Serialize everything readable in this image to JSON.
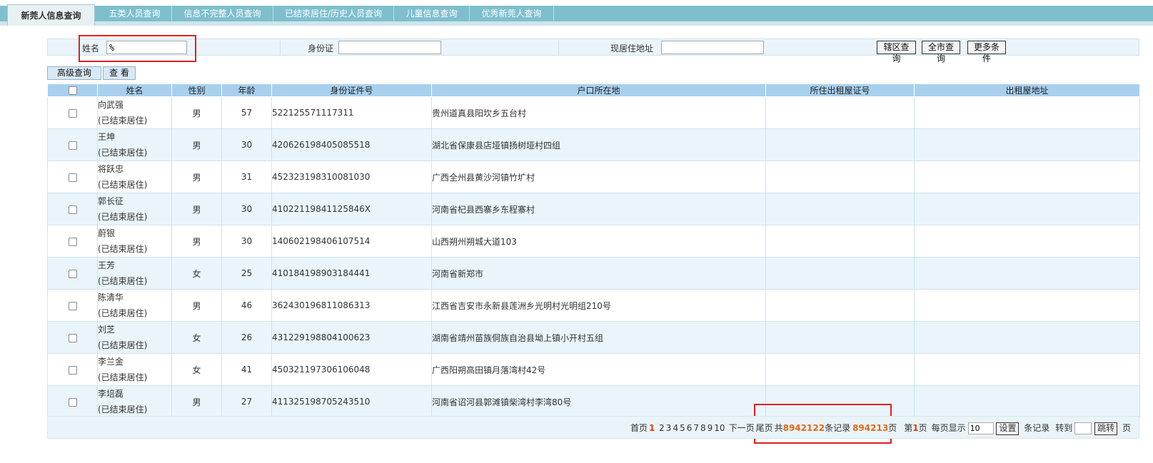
{
  "tabs": [
    {
      "label": "新莞人信息查询",
      "active": true
    },
    {
      "label": "五类人员查询",
      "active": false
    },
    {
      "label": "信息不完整人员查询",
      "active": false
    },
    {
      "label": "已结束居住/历史人员查询",
      "active": false
    },
    {
      "label": "儿童信息查询",
      "active": false
    },
    {
      "label": "优秀新莞人查询",
      "active": false
    }
  ],
  "search": {
    "name_label": "姓名",
    "name_value": "%",
    "id_label": "身份证",
    "id_value": "",
    "address_label": "现居住地址",
    "address_value": "",
    "btn_district": "辖区查询",
    "btn_city": "全市查询",
    "btn_more": "更多条件",
    "btn_advanced": "高级查询",
    "btn_view": "查 看"
  },
  "table": {
    "headers": [
      "",
      "姓名",
      "性别",
      "年龄",
      "身份证件号",
      "户口所在地",
      "所住出租屋证号",
      "出租屋地址"
    ],
    "rows": [
      {
        "name": "向武强",
        "status": "(已结束居住)",
        "gender": "男",
        "age": "57",
        "id": "522125571117311",
        "hukou": "贵州道真县阳坎乡五台村",
        "room_no": "",
        "room_addr": ""
      },
      {
        "name": "王坤",
        "status": "(已结束居住)",
        "gender": "男",
        "age": "30",
        "id": "420626198405085518",
        "hukou": "湖北省保康县店垭镇扬树垭村四组",
        "room_no": "",
        "room_addr": ""
      },
      {
        "name": "将跃忠",
        "status": "(已结束居住)",
        "gender": "男",
        "age": "31",
        "id": "452323198310081030",
        "hukou": "广西全州县黄沙河镇竹圹村",
        "room_no": "",
        "room_addr": ""
      },
      {
        "name": "郭长征",
        "status": "(已结束居住)",
        "gender": "男",
        "age": "30",
        "id": "41022119841125846X",
        "hukou": "河南省杞县西寨乡东程寨村",
        "room_no": "",
        "room_addr": ""
      },
      {
        "name": "蔚银",
        "status": "(已结束居住)",
        "gender": "男",
        "age": "30",
        "id": "140602198406107514",
        "hukou": "山西朔州朔城大道103",
        "room_no": "",
        "room_addr": ""
      },
      {
        "name": "王芳",
        "status": "(已结束居住)",
        "gender": "女",
        "age": "25",
        "id": "410184198903184441",
        "hukou": "河南省新郑市",
        "room_no": "",
        "room_addr": ""
      },
      {
        "name": "陈清华",
        "status": "(已结束居住)",
        "gender": "男",
        "age": "46",
        "id": "362430196811086313",
        "hukou": "江西省吉安市永新县莲洲乡光明村光明组210号",
        "room_no": "",
        "room_addr": ""
      },
      {
        "name": "刘芝",
        "status": "(已结束居住)",
        "gender": "女",
        "age": "26",
        "id": "431229198804100623",
        "hukou": "湖南省靖州苗族侗族自治县坳上镇小开村五组",
        "room_no": "",
        "room_addr": ""
      },
      {
        "name": "李兰金",
        "status": "(已结束居住)",
        "gender": "女",
        "age": "41",
        "id": "450321197306106048",
        "hukou": "广西阳朔高田镇月落湾村42号",
        "room_no": "",
        "room_addr": ""
      },
      {
        "name": "李培磊",
        "status": "(已结束居住)",
        "gender": "男",
        "age": "27",
        "id": "411325198705243510",
        "hukou": "河南省诏河县郭滩镇柴湾村李湾80号",
        "room_no": "",
        "room_addr": ""
      }
    ]
  },
  "pager": {
    "first": "首页",
    "current_page": "1",
    "pages": [
      "2",
      "3",
      "4",
      "5",
      "6",
      "7",
      "8",
      "9",
      "10"
    ],
    "next": "下一页",
    "last": "尾页",
    "total_prefix": "共",
    "total_records": "8942122",
    "records_label": "条记录",
    "total_pages": "894213",
    "pages_label": "页",
    "page_prefix": "第",
    "page_num": "1",
    "page_suffix": "页",
    "per_page_label": "每页显示",
    "per_page_value": "10",
    "set_btn": "设置",
    "records_suffix": "条记录",
    "goto_label": "转到",
    "goto_value": "",
    "jump_btn": "跳转",
    "goto_suffix": "页"
  }
}
